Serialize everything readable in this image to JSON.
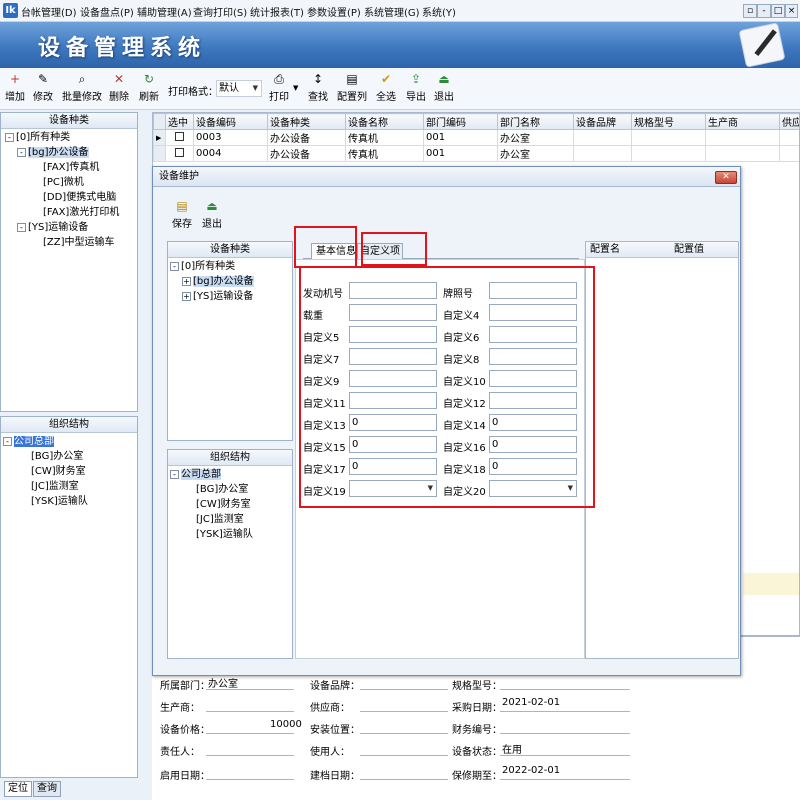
{
  "menubar": {
    "app_icon": "Ik",
    "items": [
      "台帐管理(D)",
      "设备盘点(P)",
      "辅助管理(A)",
      "查询打印(S)",
      "统计报表(T)",
      "参数设置(P)",
      "系统管理(G)",
      "系统(Y)"
    ],
    "window_buttons": [
      "▫",
      "-",
      "□",
      "×"
    ]
  },
  "banner": {
    "title": "设备管理系统"
  },
  "toolbar": {
    "buttons": [
      {
        "label": "增加",
        "icon": "add-icon",
        "glyph": "+"
      },
      {
        "label": "修改",
        "icon": "edit-icon",
        "glyph": "✎"
      },
      {
        "label": "批量修改",
        "icon": "batch-edit-icon",
        "glyph": "⌕"
      },
      {
        "label": "删除",
        "icon": "delete-icon",
        "glyph": "✕"
      },
      {
        "label": "刷新",
        "icon": "refresh-icon",
        "glyph": "↻"
      }
    ],
    "print_format_label": "打印格式：",
    "print_format_value": "默认",
    "buttons2": [
      {
        "label": "打印",
        "icon": "print-icon",
        "glyph": "⎙"
      },
      {
        "label": "查找",
        "icon": "sort-icon",
        "glyph": "↕"
      },
      {
        "label": "配置列",
        "icon": "columns-icon",
        "glyph": "▤"
      },
      {
        "label": "全选",
        "icon": "select-all-icon",
        "glyph": "✔"
      },
      {
        "label": "导出",
        "icon": "export-icon",
        "glyph": "⇪"
      },
      {
        "label": "退出",
        "icon": "exit-icon",
        "glyph": "⏏"
      }
    ]
  },
  "left_tree": {
    "title": "设备种类",
    "items": [
      "[0]所有种类",
      "[bg]办公设备",
      "[FAX]传真机",
      "[PC]微机",
      "[DD]便携式电脑",
      "[FAX]激光打印机",
      "[YS]运输设备",
      "[ZZ]中型运输车"
    ]
  },
  "left_org": {
    "title": "组织结构",
    "items": [
      "公司总部",
      "[BG]办公室",
      "[CW]财务室",
      "[JC]监测室",
      "[YSK]运输队"
    ]
  },
  "grid": {
    "columns": [
      "选中",
      "设备编码",
      "设备种类",
      "设备名称",
      "部门编码",
      "部门名称",
      "设备品牌",
      "规格型号",
      "生产商",
      "供应"
    ],
    "rows": [
      [
        "",
        "0003",
        "办公设备",
        "传真机",
        "001",
        "办公室",
        "",
        "",
        "",
        ""
      ],
      [
        "",
        "0004",
        "办公设备",
        "传真机",
        "001",
        "办公室",
        "",
        "",
        "",
        ""
      ]
    ]
  },
  "dialog": {
    "title": "设备维护",
    "close_glyph": "✕",
    "save_label": "保存",
    "exit_label": "退出",
    "tree_title": "设备种类",
    "tree_items": [
      "[0]所有种类",
      "[bg]办公设备",
      "[YS]运输设备"
    ],
    "org_title": "组织结构",
    "org_items": [
      "公司总部",
      "[BG]办公室",
      "[CW]财务室",
      "[JC]监测室",
      "[YSK]运输队"
    ],
    "tabs": [
      "基本信息",
      "自定义项"
    ],
    "config_headers": [
      "配置名",
      "配置值"
    ],
    "fields_left": [
      {
        "label": "发动机号",
        "value": ""
      },
      {
        "label": "载重",
        "value": ""
      },
      {
        "label": "自定义5",
        "value": ""
      },
      {
        "label": "自定义7",
        "value": ""
      },
      {
        "label": "自定义9",
        "value": ""
      },
      {
        "label": "自定义11",
        "value": ""
      },
      {
        "label": "自定义13",
        "value": "0"
      },
      {
        "label": "自定义15",
        "value": "0"
      },
      {
        "label": "自定义17",
        "value": "0"
      },
      {
        "label": "自定义19",
        "value": ""
      }
    ],
    "fields_right": [
      {
        "label": "牌照号",
        "value": ""
      },
      {
        "label": "自定义4",
        "value": ""
      },
      {
        "label": "自定义6",
        "value": ""
      },
      {
        "label": "自定义8",
        "value": ""
      },
      {
        "label": "自定义10",
        "value": ""
      },
      {
        "label": "自定义12",
        "value": ""
      },
      {
        "label": "自定义14",
        "value": "0"
      },
      {
        "label": "自定义16",
        "value": "0"
      },
      {
        "label": "自定义18",
        "value": "0"
      },
      {
        "label": "自定义20",
        "value": ""
      }
    ]
  },
  "bottom_detail": {
    "dept": {
      "label": "所属部门：",
      "value": "办公室"
    },
    "brand": {
      "label": "设备品牌：",
      "value": ""
    },
    "model": {
      "label": "规格型号：",
      "value": ""
    },
    "maker": {
      "label": "生产商：",
      "value": ""
    },
    "supplier": {
      "label": "供应商：",
      "value": ""
    },
    "purchase_date": {
      "label": "采购日期：",
      "value": "2021-02-01"
    },
    "price": {
      "label": "设备价格：",
      "value": "10000"
    },
    "location": {
      "label": "安装位置：",
      "value": ""
    },
    "finance_no": {
      "label": "财务编号：",
      "value": ""
    },
    "owner": {
      "label": "责任人：",
      "value": ""
    },
    "user": {
      "label": "使用人：",
      "value": ""
    },
    "status": {
      "label": "设备状态：",
      "value": "在用"
    },
    "start_date": {
      "label": "启用日期：",
      "value": ""
    },
    "archive_date": {
      "label": "建档日期：",
      "value": ""
    },
    "warranty": {
      "label": "保修期至：",
      "value": "2022-02-01"
    }
  },
  "bottom_tabs": [
    "定位",
    "查询"
  ]
}
